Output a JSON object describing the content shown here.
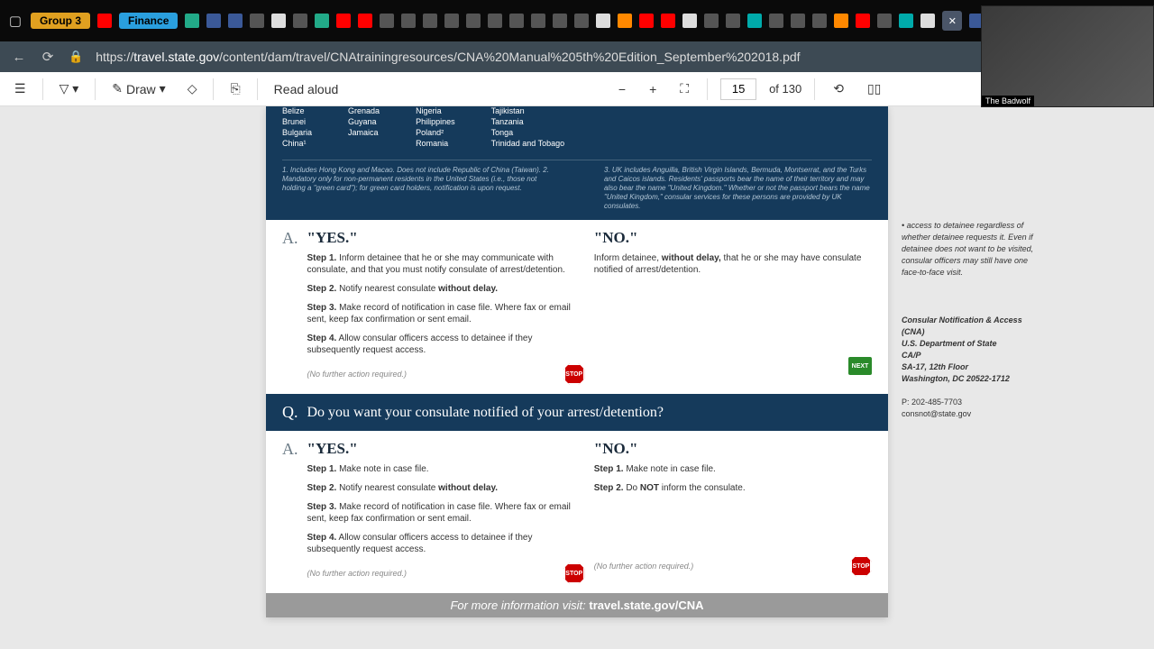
{
  "titlebar": {
    "group_label": "Group 3",
    "finance_label": "Finance"
  },
  "url": {
    "domain": "travel.state.gov",
    "path": "/content/dam/travel/CNAtrainingresources/CNA%20Manual%205th%20Edition_September%202018.pdf"
  },
  "toolbar": {
    "draw": "Draw",
    "read_aloud": "Read aloud",
    "page_current": "15",
    "page_total": "of 130"
  },
  "countries": {
    "c1": [
      "Belize",
      "Brunei",
      "Bulgaria",
      "China¹"
    ],
    "c2": [
      "Grenada",
      "Guyana",
      "Jamaica"
    ],
    "c3": [
      "Nigeria",
      "Philippines",
      "Poland²",
      "Romania"
    ],
    "c4": [
      "Tajikistan",
      "Tanzania",
      "Tonga",
      "Trinidad and Tobago"
    ]
  },
  "footnotes": {
    "left": "1. Includes Hong Kong and Macao. Does not include Republic of China (Taiwan).\n2. Mandatory only for non-permanent residents in the United States (i.e., those not holding a \"green card\"); for green card holders, notification is upon request.",
    "right": "3. UK includes Anguilla, British Virgin Islands, Bermuda, Montserrat, and the Turks and Caicos islands. Residents' passports bear the name of their territory and may also bear the name \"United Kingdom.\" Whether or not the passport bears the name \"United Kingdom,\" consular services for these persons are provided by UK consulates."
  },
  "qa1": {
    "letter": "A.",
    "yes_head": "\"YES.\"",
    "no_head": "\"NO.\"",
    "yes_step1_label": "Step 1.",
    "yes_step1": " Inform detainee that he or she may communicate with consulate, and that you must notify consulate of arrest/detention.",
    "yes_step2_label": "Step 2.",
    "yes_step2_a": " Notify nearest consulate ",
    "yes_step2_b": "without delay.",
    "yes_step3_label": "Step 3.",
    "yes_step3": " Make record of notification in case file. Where fax or email sent, keep fax confirmation or sent email.",
    "yes_step4_label": "Step 4.",
    "yes_step4": " Allow consular officers access to detainee if they subsequently request access.",
    "yes_note": "(No further action required.)",
    "no_text_a": "Inform detainee, ",
    "no_text_b": "without delay,",
    "no_text_c": " that he or she may have consulate notified of arrest/detention.",
    "stop": "STOP",
    "next": "NEXT"
  },
  "question": {
    "letter": "Q.",
    "text": "Do you want your consulate notified of your arrest/detention?"
  },
  "qa2": {
    "letter": "A.",
    "yes_head": "\"YES.\"",
    "no_head": "\"NO.\"",
    "yes_step1_label": "Step 1.",
    "yes_step1": " Make note in case file.",
    "yes_step2_label": "Step 2.",
    "yes_step2_a": " Notify nearest consulate ",
    "yes_step2_b": "without delay.",
    "yes_step3_label": "Step 3.",
    "yes_step3": " Make record of notification in case file. Where fax or email sent, keep fax confirmation or sent email.",
    "yes_step4_label": "Step 4.",
    "yes_step4": " Allow consular officers access to detainee if they subsequently request access.",
    "yes_note": "(No further action required.)",
    "no_step1_label": "Step 1.",
    "no_step1": " Make note in case file.",
    "no_step2_label": "Step 2.",
    "no_step2_a": " Do ",
    "no_step2_b": "NOT",
    "no_step2_c": " inform the consulate.",
    "no_note": "(No further action required.)",
    "stop": "STOP"
  },
  "sidebar": {
    "block1": "access to detainee regardless of whether detainee requests it. Even if detainee does not want to be visited, consular officers may still have one face-to-face visit.",
    "org_title": "Consular Notification & Access (CNA)",
    "dept": "U.S. Department of State",
    "cap": "CA/P",
    "addr1": "SA-17, 12th Floor",
    "addr2": "Washington, DC 20522-1712",
    "phone": "P: 202-485-7703",
    "email": "consnot@state.gov"
  },
  "footer": {
    "prefix": "For more information visit: ",
    "link": "travel.state.gov/CNA"
  },
  "webcam": {
    "label": "The Badwolf"
  }
}
